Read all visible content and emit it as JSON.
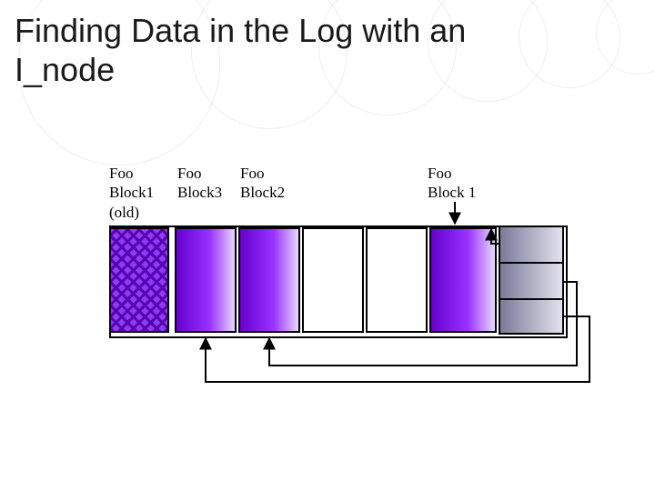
{
  "title": "Finding Data in the Log with an I_node",
  "labels": {
    "block1_old": "Foo\nBlock1\n(old)",
    "block3": "Foo\nBlock3",
    "block2": "Foo\nBlock2",
    "block1_new": "Foo\nBlock 1"
  },
  "colors": {
    "purple_dark": "#6600cc",
    "purple_light": "#9933ff",
    "grey_block": "#7a7a99"
  },
  "chart_data": {
    "type": "table",
    "description": "Linear log showing old/new data blocks and an inode with three pointer slots",
    "log_blocks": [
      {
        "index": 0,
        "content": "Foo Block1 (old)",
        "pattern": "cross-hatch",
        "status": "stale"
      },
      {
        "index": 1,
        "content": "Foo Block3",
        "pattern": "purple",
        "status": "live"
      },
      {
        "index": 2,
        "content": "Foo Block2",
        "pattern": "purple",
        "status": "live"
      },
      {
        "index": 3,
        "content": "(empty)",
        "pattern": "none",
        "status": "unused"
      },
      {
        "index": 4,
        "content": "(empty)",
        "pattern": "none",
        "status": "unused"
      },
      {
        "index": 5,
        "content": "Foo Block1 (new)",
        "pattern": "purple",
        "status": "live"
      },
      {
        "index": 6,
        "content": "inode",
        "pattern": "grey",
        "status": "metadata",
        "slots": 3
      }
    ],
    "inode_pointers": [
      {
        "slot": 0,
        "points_to_index": 5,
        "points_to": "Foo Block1 (new)"
      },
      {
        "slot": 1,
        "points_to_index": 2,
        "points_to": "Foo Block2"
      },
      {
        "slot": 2,
        "points_to_index": 1,
        "points_to": "Foo Block3"
      }
    ]
  }
}
